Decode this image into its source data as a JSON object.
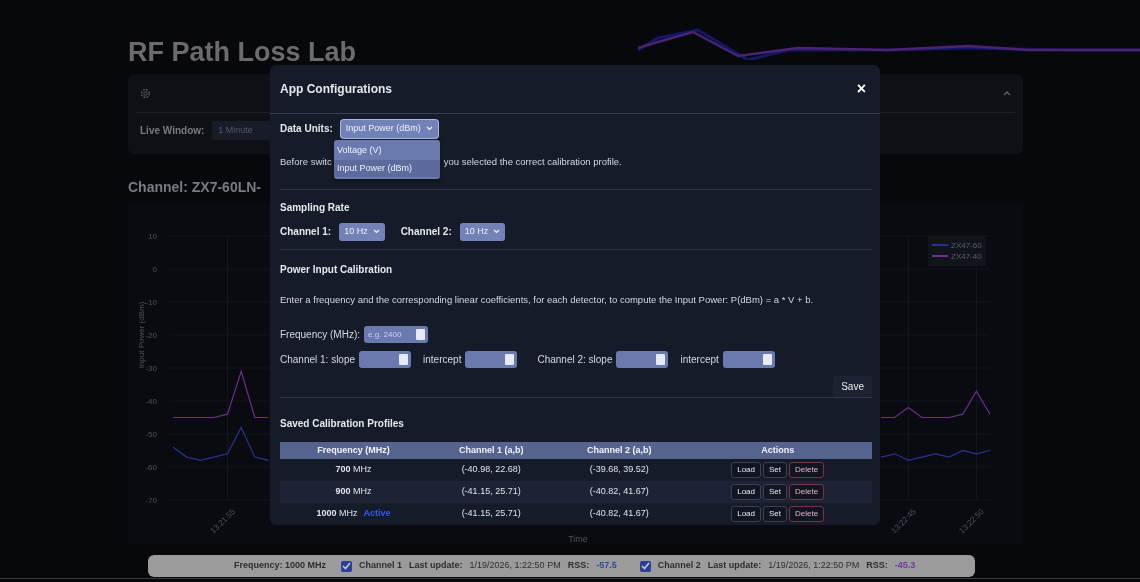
{
  "app_title": "RF Path Loss Lab",
  "settings_panel": {
    "expanded": true,
    "live_window_label": "Live Window:",
    "live_window_value": "1 Minute"
  },
  "channel_heading": "Channel: ZX7-60LN-",
  "chart": {
    "chart_data": {
      "type": "line",
      "grid": true,
      "legend": "upper right",
      "ylabel": "Input Power (dBm)",
      "xlabel": "Time",
      "ylim": [
        -70,
        10
      ],
      "yticks": [
        10,
        0,
        -10,
        -20,
        -30,
        -40,
        -50,
        -60,
        -70
      ],
      "categories": [
        null,
        null,
        null,
        null,
        "13:21:55",
        null,
        null,
        null,
        null,
        null,
        null,
        null,
        null,
        null,
        null,
        null,
        null,
        null,
        null,
        null,
        null,
        null,
        null,
        null,
        null,
        null,
        null,
        null,
        null,
        null,
        null,
        null,
        null,
        null,
        null,
        null,
        null,
        null,
        null,
        null,
        null,
        null,
        null,
        null,
        null,
        null,
        null,
        null,
        null,
        null,
        null,
        null,
        null,
        null,
        "13:22:45",
        null,
        null,
        null,
        null,
        "13:22:50",
        null
      ],
      "series": [
        {
          "name": "ZX47-60",
          "color": "#2b3192",
          "values": [
            -54,
            -57,
            -58,
            -57,
            -56,
            -48,
            -57,
            -58,
            null,
            null,
            null,
            null,
            null,
            null,
            null,
            null,
            null,
            null,
            null,
            null,
            null,
            null,
            null,
            null,
            null,
            null,
            null,
            null,
            null,
            null,
            null,
            null,
            null,
            null,
            null,
            null,
            null,
            null,
            null,
            null,
            null,
            null,
            null,
            null,
            null,
            null,
            null,
            null,
            null,
            null,
            null,
            null,
            -57,
            -56,
            -58,
            -57,
            -56,
            -57,
            -55,
            -56,
            -55
          ]
        },
        {
          "name": "ZX47-40",
          "color": "#6b2f8e",
          "values": [
            -45,
            -45,
            -45,
            -45,
            -44,
            -31,
            -45,
            -45,
            null,
            null,
            null,
            null,
            null,
            null,
            null,
            null,
            null,
            null,
            null,
            null,
            null,
            null,
            null,
            null,
            null,
            null,
            null,
            null,
            null,
            null,
            null,
            null,
            null,
            null,
            null,
            null,
            null,
            null,
            null,
            null,
            null,
            null,
            null,
            null,
            null,
            null,
            null,
            null,
            null,
            null,
            null,
            null,
            -45,
            -45,
            -42,
            -45,
            -45,
            -45,
            -44,
            -37,
            -44
          ]
        }
      ]
    }
  },
  "modal": {
    "title": "App Configurations",
    "close": "×",
    "data_units": {
      "label": "Data Units:",
      "value": "Input Power (dBm)",
      "expanded": true,
      "options": [
        {
          "label": "Voltage (V)",
          "selected": false
        },
        {
          "label": "Input Power (dBm)",
          "selected": true
        }
      ]
    },
    "note_parts": [
      "Before switc",
      "you selected the correct calibration profile."
    ],
    "sampling_rate": {
      "title": "Sampling Rate",
      "channels": [
        {
          "label": "Channel 1:",
          "value": "10 Hz"
        },
        {
          "label": "Channel 2:",
          "value": "10 Hz"
        }
      ]
    },
    "calibration": {
      "title": "Power Input Calibration",
      "description": "Enter a frequency and the corresponding linear coefficients, for each detector, to compute the Input Power: P(dBm) = a * V + b.",
      "frequency_label": "Frequency (MHz):",
      "frequency_placeholder": "e.g. 2400",
      "channels": [
        {
          "slope_label": "Channel 1: slope",
          "intercept_label": "intercept"
        },
        {
          "slope_label": "Channel 2: slope",
          "intercept_label": "intercept"
        }
      ],
      "save": "Save"
    },
    "profiles": {
      "title": "Saved Calibration Profiles",
      "active_label": "Active",
      "columns": [
        "Frequency (MHz)",
        "Channel 1 (a,b)",
        "Channel 2 (a,b)",
        "Actions"
      ],
      "rows": [
        {
          "frequency": "**700** MHz",
          "active": false,
          "channel_1": "(-40.98, 22.68)",
          "channel_2": "(-39.68, 39.52)",
          "actions": [
            "Load",
            "Set",
            "Delete"
          ]
        },
        {
          "frequency": "**900** MHz",
          "active": false,
          "channel_1": "(-41.15, 25.71)",
          "channel_2": "(-40.82, 41.67)",
          "actions": [
            "Load",
            "Set",
            "Delete"
          ]
        },
        {
          "frequency": "**1000** MHz",
          "active": true,
          "channel_1": "(-41.15, 25.71)",
          "channel_2": "(-40.82, 41.67)",
          "actions": [
            "Load",
            "Set",
            "Delete"
          ]
        }
      ]
    }
  },
  "status_bar": {
    "frequency": "Frequency: 1000 MHz",
    "channels": [
      {
        "checked": true,
        "name": "Channel 1",
        "update_label": "Last update:",
        "update_value": "1/19/2026, 1:22:50 PM",
        "rss_label": "RSS:",
        "rss_value": "-57.5",
        "color": "#34489e"
      },
      {
        "checked": true,
        "name": "Channel 2",
        "update_label": "Last update:",
        "update_value": "1/19/2026, 1:22:50 PM",
        "rss_label": "RSS:",
        "rss_value": "-45.3",
        "color": "#6f3a9e"
      }
    ]
  }
}
